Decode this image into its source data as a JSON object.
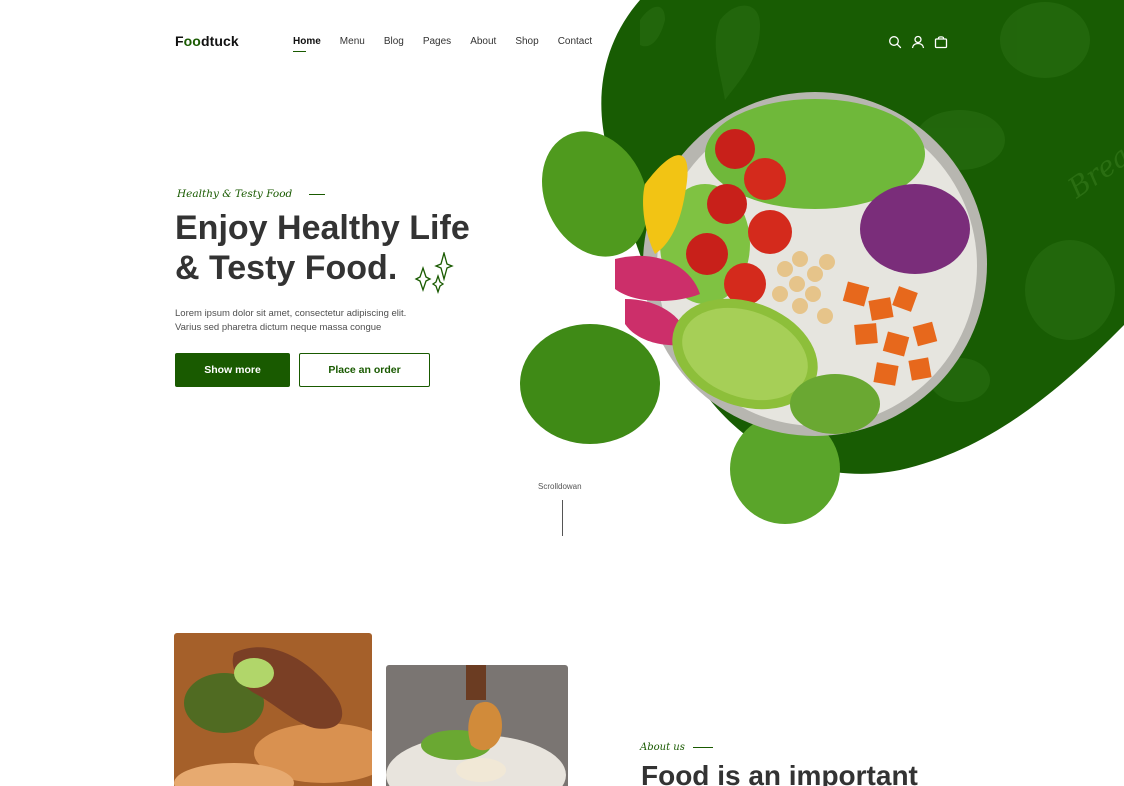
{
  "brand": {
    "logo_prefix": "F",
    "logo_accent": "oo",
    "logo_suffix": "dtuck"
  },
  "nav": {
    "items": [
      {
        "label": "Home"
      },
      {
        "label": "Menu"
      },
      {
        "label": "Blog"
      },
      {
        "label": "Pages"
      },
      {
        "label": "About"
      },
      {
        "label": "Shop"
      },
      {
        "label": "Contact"
      }
    ],
    "active": "Home"
  },
  "header_icons": [
    "search-icon",
    "user-icon",
    "bag-icon"
  ],
  "hero": {
    "tagline": "Healthy & Testy Food",
    "title_line1": "Enjoy Healthy Life",
    "title_line2": "& Testy Food.",
    "description_line1": "Lorem ipsum dolor sit amet, consectetur adipiscing elit.",
    "description_line2": "Varius sed pharetra dictum neque massa congue",
    "primary_button": "Show more",
    "secondary_button": "Place an order",
    "scroll_label": "Scrolldowan"
  },
  "about": {
    "tagline": "About us",
    "title": "Food is an important"
  },
  "colors": {
    "accent": "#195A00",
    "text": "#333333",
    "background": "#ffffff"
  }
}
